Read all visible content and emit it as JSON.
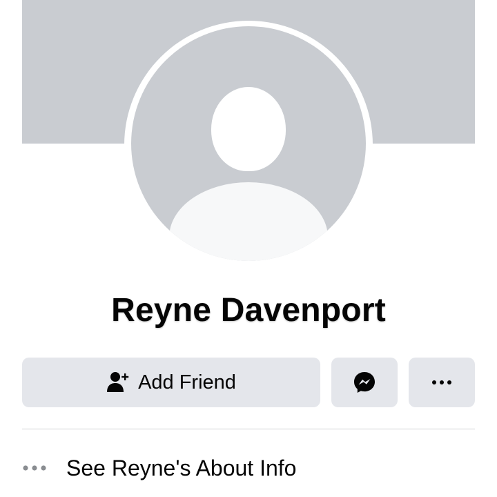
{
  "profile": {
    "name": "Reyne Davenport"
  },
  "actions": {
    "add_friend_label": "Add Friend",
    "add_friend_icon": "add-friend-icon",
    "message_icon": "messenger-icon",
    "more_icon": "more-dots-icon"
  },
  "about": {
    "label": "See Reyne's About Info",
    "icon": "more-dots-icon"
  },
  "colors": {
    "cover": "#c9ccd1",
    "button_bg": "#e4e6eb",
    "text": "#050505",
    "muted_icon": "#65676b"
  }
}
